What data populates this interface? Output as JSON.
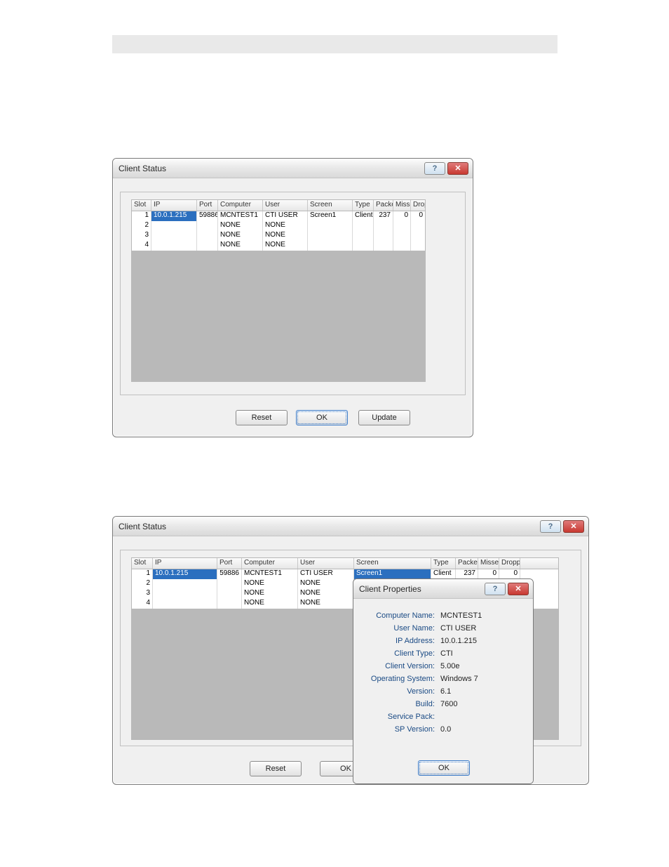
{
  "window1": {
    "title": "Client Status",
    "columns": [
      "Slot",
      "IP",
      "Port",
      "Computer",
      "User",
      "Screen",
      "Type",
      "Packe",
      "Misse",
      "Dropp"
    ],
    "rows": [
      {
        "slot": "1",
        "ip": "10.0.1.215",
        "port": "59886",
        "computer": "MCNTEST1",
        "user": "CTI USER",
        "screen": "Screen1",
        "type": "Client",
        "packets": "237",
        "missed": "0",
        "dropped": "0"
      },
      {
        "slot": "2",
        "ip": "",
        "port": "",
        "computer": "NONE",
        "user": "NONE",
        "screen": "",
        "type": "",
        "packets": "",
        "missed": "",
        "dropped": ""
      },
      {
        "slot": "3",
        "ip": "",
        "port": "",
        "computer": "NONE",
        "user": "NONE",
        "screen": "",
        "type": "",
        "packets": "",
        "missed": "",
        "dropped": ""
      },
      {
        "slot": "4",
        "ip": "",
        "port": "",
        "computer": "NONE",
        "user": "NONE",
        "screen": "",
        "type": "",
        "packets": "",
        "missed": "",
        "dropped": ""
      }
    ],
    "buttons": {
      "reset": "Reset",
      "ok": "OK",
      "update": "Update"
    }
  },
  "window2": {
    "title": "Client Status",
    "columns": [
      "Slot",
      "IP",
      "Port",
      "Computer",
      "User",
      "Screen",
      "Type",
      "Packe",
      "Misse",
      "Dropp"
    ],
    "rows": [
      {
        "slot": "1",
        "ip": "10.0.1.215",
        "port": "59886",
        "computer": "MCNTEST1",
        "user": "CTI USER",
        "screen": "Screen1",
        "type": "Client",
        "packets": "237",
        "missed": "0",
        "dropped": "0"
      },
      {
        "slot": "2",
        "ip": "",
        "port": "",
        "computer": "NONE",
        "user": "NONE",
        "screen": "",
        "type": "",
        "packets": "",
        "missed": "",
        "dropped": ""
      },
      {
        "slot": "3",
        "ip": "",
        "port": "",
        "computer": "NONE",
        "user": "NONE",
        "screen": "",
        "type": "",
        "packets": "",
        "missed": "",
        "dropped": ""
      },
      {
        "slot": "4",
        "ip": "",
        "port": "",
        "computer": "NONE",
        "user": "NONE",
        "screen": "",
        "type": "",
        "packets": "",
        "missed": "",
        "dropped": ""
      }
    ],
    "buttons": {
      "reset": "Reset",
      "ok": "OK"
    }
  },
  "props": {
    "title": "Client Properties",
    "items": {
      "computer_name": {
        "label": "Computer Name:",
        "value": "MCNTEST1"
      },
      "user_name": {
        "label": "User Name:",
        "value": "CTI USER"
      },
      "ip_address": {
        "label": "IP Address:",
        "value": "10.0.1.215"
      },
      "client_type": {
        "label": "Client Type:",
        "value": "CTI"
      },
      "client_version": {
        "label": "Client Version:",
        "value": "5.00e"
      },
      "os": {
        "label": "Operating System:",
        "value": "Windows 7"
      },
      "version": {
        "label": "Version:",
        "value": "6.1"
      },
      "build": {
        "label": "Build:",
        "value": "7600"
      },
      "service_pack": {
        "label": "Service Pack:",
        "value": ""
      },
      "sp_version": {
        "label": "SP Version:",
        "value": "0.0"
      }
    },
    "ok": "OK"
  }
}
